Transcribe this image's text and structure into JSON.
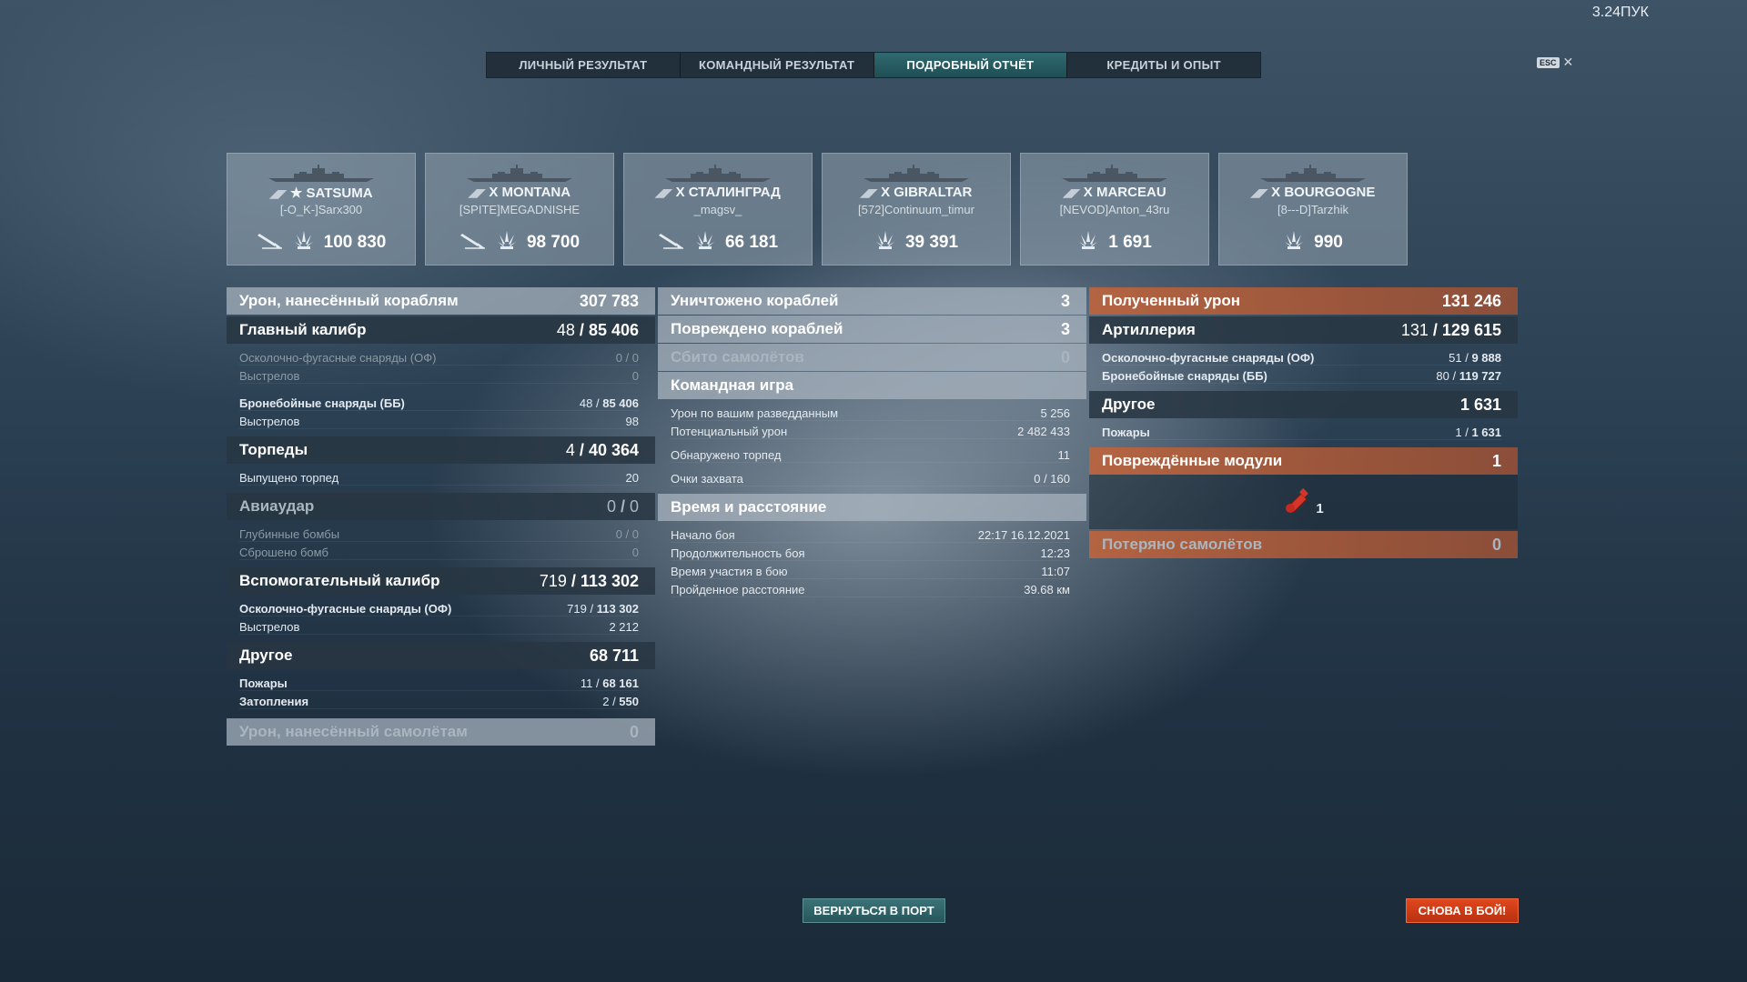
{
  "version": "3.24ПУК",
  "tabs": [
    {
      "label": "ЛИЧНЫЙ РЕЗУЛЬТАТ",
      "active": false
    },
    {
      "label": "КОМАНДНЫЙ РЕЗУЛЬТАТ",
      "active": false
    },
    {
      "label": "ПОДРОБНЫЙ ОТЧЁТ",
      "active": true
    },
    {
      "label": "КРЕДИТЫ И ОПЫТ",
      "active": false
    }
  ],
  "esc": {
    "key": "ESC",
    "close": "✕"
  },
  "ships": [
    {
      "tier": "★",
      "name": "SATSUMA",
      "player": "[-O_K-]Sarx300",
      "damage": "100 830",
      "torpedo": true
    },
    {
      "tier": "X",
      "name": "MONTANA",
      "player": "[SPITE]MEGADNISHE",
      "damage": "98 700",
      "torpedo": true
    },
    {
      "tier": "X",
      "name": "СТАЛИНГРАД",
      "player": "_magsv_",
      "damage": "66 181",
      "torpedo": true
    },
    {
      "tier": "X",
      "name": "GIBRALTAR",
      "player": "[572]Continuum_timur",
      "damage": "39 391",
      "torpedo": false
    },
    {
      "tier": "X",
      "name": "MARCEAU",
      "player": "[NEVOD]Anton_43ru",
      "damage": "1 691",
      "torpedo": false
    },
    {
      "tier": "X",
      "name": "BOURGOGNE",
      "player": "[8---D]Tarzhik",
      "damage": "990",
      "torpedo": false
    }
  ],
  "left": {
    "damage_ships": {
      "label": "Урон, нанесённый кораблям",
      "value": "307 783"
    },
    "main_battery": {
      "label": "Главный калибр",
      "a": "48",
      "b": "85 406",
      "he": {
        "label": "Осколочно-фугасные снаряды (ОФ)",
        "a": "0",
        "b": "0"
      },
      "he_shots": {
        "label": "Выстрелов",
        "value": "0"
      },
      "ap": {
        "label": "Бронебойные снаряды (ББ)",
        "a": "48",
        "b": "85 406"
      },
      "ap_shots": {
        "label": "Выстрелов",
        "value": "98"
      }
    },
    "torpedoes": {
      "label": "Торпеды",
      "a": "4",
      "b": "40 364",
      "fired": {
        "label": "Выпущено торпед",
        "value": "20"
      }
    },
    "airstrike": {
      "label": "Авиаудар",
      "a": "0",
      "b": "0",
      "depth": {
        "label": "Глубинные бомбы",
        "a": "0",
        "b": "0"
      },
      "dropped": {
        "label": "Сброшено бомб",
        "value": "0"
      }
    },
    "secondary": {
      "label": "Вспомогательный калибр",
      "a": "719",
      "b": "113 302",
      "he": {
        "label": "Осколочно-фугасные снаряды (ОФ)",
        "a": "719",
        "b": "113 302"
      },
      "shots": {
        "label": "Выстрелов",
        "value": "2 212"
      }
    },
    "other": {
      "label": "Другое",
      "value": "68 711",
      "fires": {
        "label": "Пожары",
        "a": "11",
        "b": "68 161"
      },
      "floods": {
        "label": "Затопления",
        "a": "2",
        "b": "550"
      }
    },
    "damage_planes": {
      "label": "Урон, нанесённый самолётам",
      "value": "0"
    }
  },
  "middle": {
    "destroyed": {
      "label": "Уничтожено кораблей",
      "value": "3"
    },
    "damaged": {
      "label": "Повреждено кораблей",
      "value": "3"
    },
    "planes_shot": {
      "label": "Сбито самолётов",
      "value": "0"
    },
    "team": {
      "label": "Командная игра",
      "spotting": {
        "label": "Урон по вашим разведданным",
        "value": "5 256"
      },
      "potential": {
        "label": "Потенциальный урон",
        "value": "2 482 433"
      },
      "torps_spotted": {
        "label": "Обнаружено торпед",
        "value": "11"
      },
      "capture": {
        "label": "Очки захвата",
        "value": "0 / 160"
      }
    },
    "time": {
      "label": "Время и расстояние",
      "start": {
        "label": "Начало боя",
        "value": "22:17  16.12.2021"
      },
      "duration": {
        "label": "Продолжительность боя",
        "value": "12:23"
      },
      "participation": {
        "label": "Время участия в бою",
        "value": "11:07"
      },
      "distance": {
        "label": "Пройденное расстояние",
        "value": "39.68 км"
      }
    }
  },
  "right": {
    "received": {
      "label": "Полученный урон",
      "value": "131 246"
    },
    "artillery": {
      "label": "Артиллерия",
      "a": "131",
      "b": "129 615",
      "he": {
        "label": "Осколочно-фугасные снаряды (ОФ)",
        "a": "51",
        "b": "9 888"
      },
      "ap": {
        "label": "Бронебойные снаряды (ББ)",
        "a": "80",
        "b": "119 727"
      }
    },
    "other": {
      "label": "Другое",
      "value": "1 631",
      "fires": {
        "label": "Пожары",
        "a": "1",
        "b": "1 631"
      }
    },
    "modules": {
      "label": "Повреждённые модули",
      "value": "1",
      "item_count": "1"
    },
    "planes_lost": {
      "label": "Потеряно самолётов",
      "value": "0"
    }
  },
  "buttons": {
    "port": "ВЕРНУТЬСЯ В ПОРТ",
    "battle": "СНОВА В БОЙ!"
  },
  "colors": {
    "accent_teal": "#2f6a70",
    "accent_orange": "#e0471f",
    "received_orange": "#be643c"
  }
}
